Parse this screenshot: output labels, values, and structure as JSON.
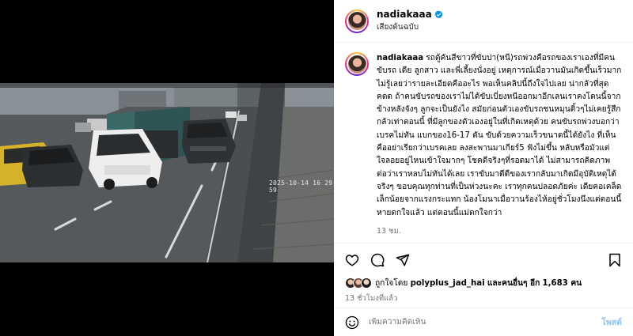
{
  "video": {
    "timestamp": "2025-10-14 16 29 59"
  },
  "post": {
    "username": "nadiakaaa",
    "audio_label": "เสียงต้นฉบับ",
    "caption": "รถตู้คันสีขาวที่ขับปา(หนี)รถพ่วงคือรถของเราเองที่มีคนขับรถ เดีย ลูกสาว และพี่เลี้ยงนั่งอยู่ เหตุการณ์เมื่อวานมันเกิดขึ้นเร็วมาก ไม่รู้เลยว่ารายละเอียดคืออะไร พอเห็นคลิปนี้ถึงใจไปเลย น่ากลัวที่สุดคดด ถ้าคนขับรถของเราไม่ได้ขับเบี่ยงหนีออกมาอีกเลนเราคงโดนนี้จากข้างหลังจังๆ ลูกจะเป็นยังไง สมัยก่อนตัวเองขับรถชนหมุนติ้วๆไม่เคยรู้สึกกลัวเท่าตอนนี้ ที่มีลูกของตัวเองอยู่ในที่เกิดเหตุด้วย คนขับรถพ่วงบอกว่าเบรคไม่ทัน แบกของ16-17 ตัน ขับด้วยความเร็วขนาดนี้ได้ยังไง ที่เห็นคืออย่าเรียกว่าเบรคเลย ลงสะพานมาเกียร์5 ฟังไม่ขึ้น หลับหรือมัวแต่ใจลอยอยู่ไหนเข้าใจมากๆ โชคดีจริงๆที่รอดมาได้ ไม่สามารถคิดภาพต่อว่าเราหลบไม่ทันได้เลย เราขับมาดีดีของเรากลับมาเกิดมีอุบัติเหตุได้จริงๆ ขอบคุณทุกท่านที่เป็นห่วงนะคะ เราทุกคนปลอดภัยค่ะ เดียคอเคล็ดเล็กน้อยจากแรงกระแทก น้องโมนาเมื่อวานร้องไห้อยู่ชั่วโมงนึงแต่ตอนนี้หายตกใจแล้ว แต่ตอนนี้แม่ตกใจกว่า",
    "caption_time": "13 ชม.",
    "likes_prefix": "ถูกใจโดย",
    "likes_user": "polyplus_jad_hai",
    "likes_middle": "และคนอื่นๆ อีก",
    "likes_count": "1,683 คน",
    "post_time": "13 ชั่วโมงที่แล้ว"
  },
  "comment": {
    "placeholder": "เพิ่มความคิดเห็น",
    "post_label": "โพสต์"
  },
  "colors": {
    "verified": "#0095f6",
    "post_button": "#8dc3fa",
    "secondary_text": "#737373"
  },
  "icons": [
    "mute-icon",
    "heart-icon",
    "comment-icon",
    "share-icon",
    "bookmark-icon",
    "emoji-icon",
    "verified-icon"
  ]
}
